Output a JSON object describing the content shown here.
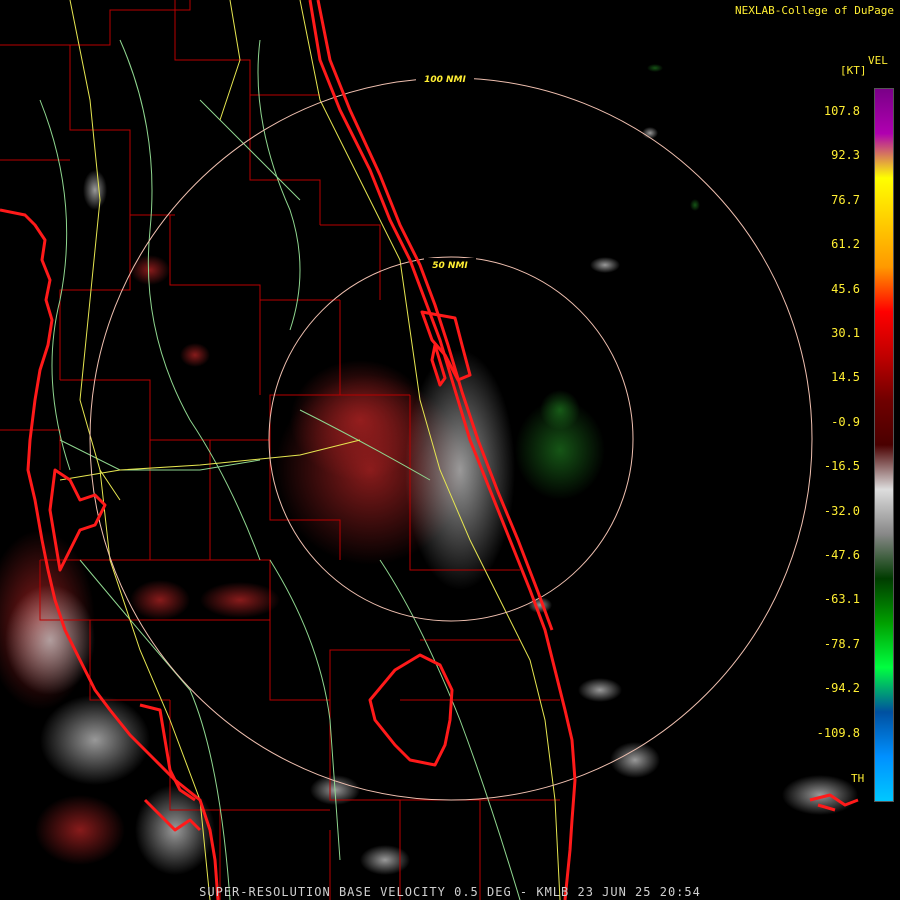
{
  "header": {
    "credit": "NEXLAB-College of DuPage"
  },
  "product": {
    "caption": "SUPER-RESOLUTION BASE VELOCITY 0.5 DEG - KMLB 23 JUN 25 20:54"
  },
  "range_rings": [
    {
      "label": "100 NMI"
    },
    {
      "label": "50 NMI"
    }
  ],
  "legend": {
    "product_code": "VEL",
    "unit": "[KT]",
    "footer_code": "TH",
    "ticks": [
      "107.8",
      "92.3",
      "76.7",
      "61.2",
      "45.6",
      "30.1",
      "14.5",
      "-0.9",
      "-16.5",
      "-32.0",
      "-47.6",
      "-63.1",
      "-78.7",
      "-94.2",
      "-109.8"
    ],
    "color_stops": [
      "#7a0088",
      "#b000b0",
      "#ffff00",
      "#ffcc00",
      "#ff9900",
      "#ff0000",
      "#c00000",
      "#700000",
      "#4a0000",
      "#dddddd",
      "#888888",
      "#003c00",
      "#00a000",
      "#00ff40",
      "#0050a0",
      "#0090ff",
      "#00c8ff"
    ]
  },
  "colors": {
    "background": "#000000",
    "coastline": "#ff1a1a",
    "county_lines": "#b80000",
    "roads_primary": "#e6e650",
    "roads_secondary": "#8fd68f",
    "ring": "#f0c0b0",
    "text": "#ffee33"
  }
}
